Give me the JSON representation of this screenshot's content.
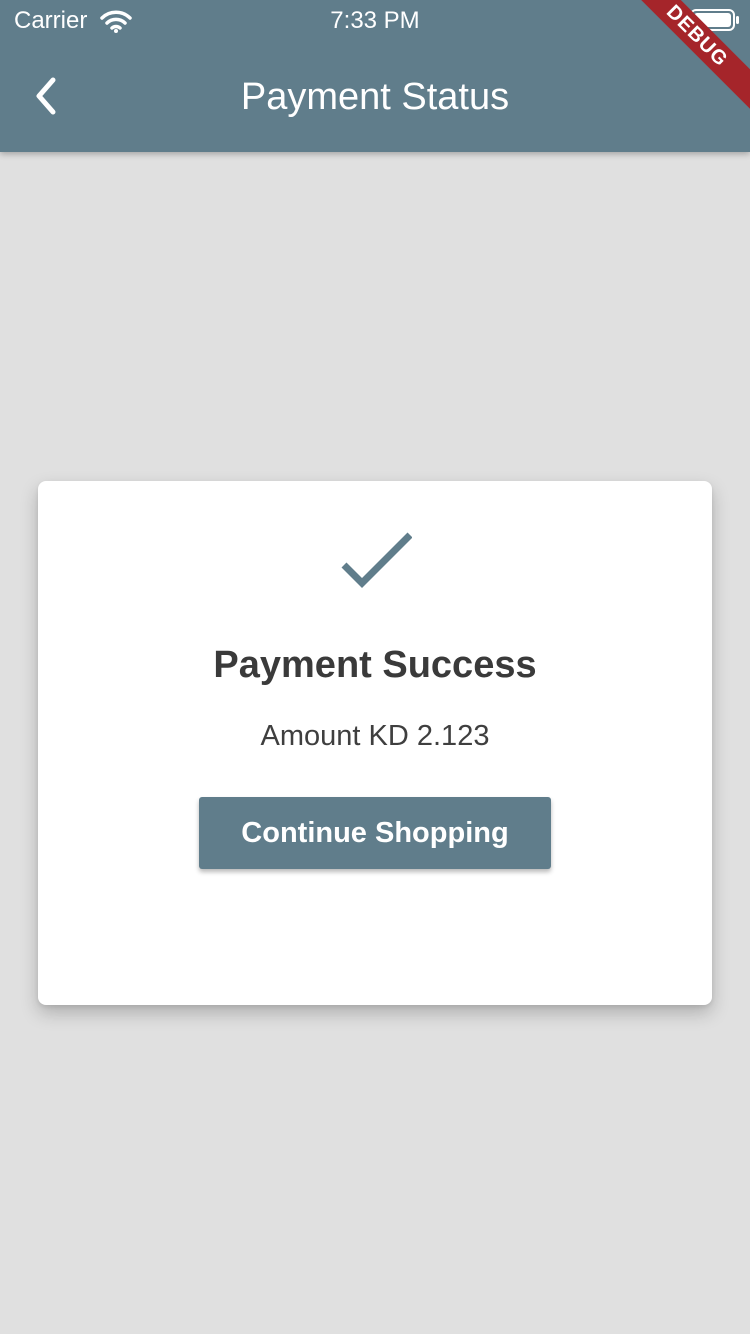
{
  "status_bar": {
    "carrier": "Carrier",
    "time": "7:33 PM"
  },
  "app_bar": {
    "title": "Payment Status",
    "back_icon": "chevron-left-icon",
    "debug_banner": "DEBUG"
  },
  "card": {
    "status_icon": "check-icon",
    "title": "Payment Success",
    "amount": "Amount KD 2.123",
    "button_label": "Continue Shopping"
  },
  "colors": {
    "primary": "#607d8b",
    "background": "#e0e0e0",
    "card": "#ffffff",
    "text_dark": "#3a3a3a",
    "debug_banner": "#a5252a"
  }
}
